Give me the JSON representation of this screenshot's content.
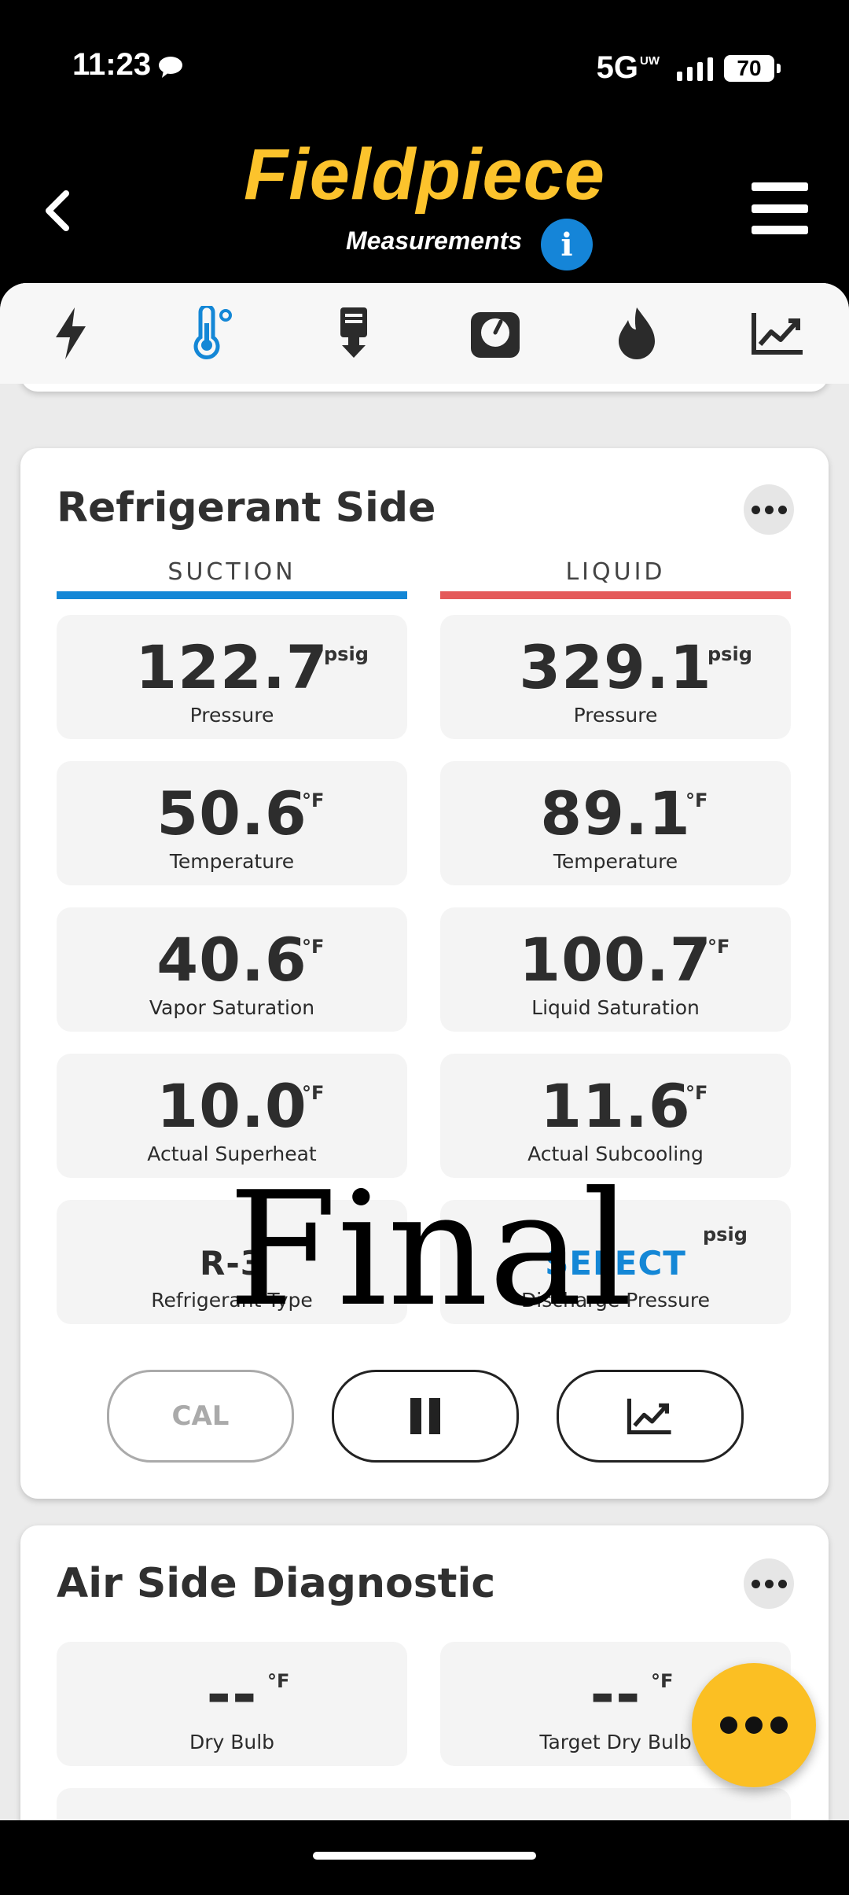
{
  "status": {
    "time": "11:23",
    "network": "5G",
    "network_sup": "UW",
    "battery": "70"
  },
  "header": {
    "logo": "Fieldpiece",
    "subtitle": "Measurements"
  },
  "tabs": [
    "electrical-tab",
    "temperature-tab",
    "install-tab",
    "gauge-tab",
    "combustion-tab",
    "charts-tab"
  ],
  "refrigerant": {
    "title": "Refrigerant Side",
    "suction_header": "SUCTION",
    "liquid_header": "LIQUID",
    "suction_color": "#1487d6",
    "liquid_color": "#e45a5a",
    "suction": [
      {
        "value": "122.7",
        "unit": "psig",
        "label": "Pressure"
      },
      {
        "value": "50.6",
        "unit": "°F",
        "label": "Temperature"
      },
      {
        "value": "40.6",
        "unit": "°F",
        "label": "Vapor Saturation"
      },
      {
        "value": "10.0",
        "unit": "°F",
        "label": "Actual Superheat"
      },
      {
        "value": "R-3",
        "unit": "",
        "label": "Refrigerant Type"
      }
    ],
    "liquid": [
      {
        "value": "329.1",
        "unit": "psig",
        "label": "Pressure"
      },
      {
        "value": "89.1",
        "unit": "°F",
        "label": "Temperature"
      },
      {
        "value": "100.7",
        "unit": "°F",
        "label": "Liquid Saturation"
      },
      {
        "value": "11.6",
        "unit": "°F",
        "label": "Actual Subcooling"
      },
      {
        "value": "SELECT",
        "unit": "psig",
        "label": "Discharge Pressure"
      }
    ],
    "cal_label": "CAL"
  },
  "air": {
    "title": "Air Side Diagnostic",
    "tiles": [
      {
        "value": "--",
        "unit": "°F",
        "label": "Dry Bulb"
      },
      {
        "value": "--",
        "unit": "°F",
        "label": "Target Dry Bulb"
      }
    ]
  },
  "overlay_text": "Final"
}
